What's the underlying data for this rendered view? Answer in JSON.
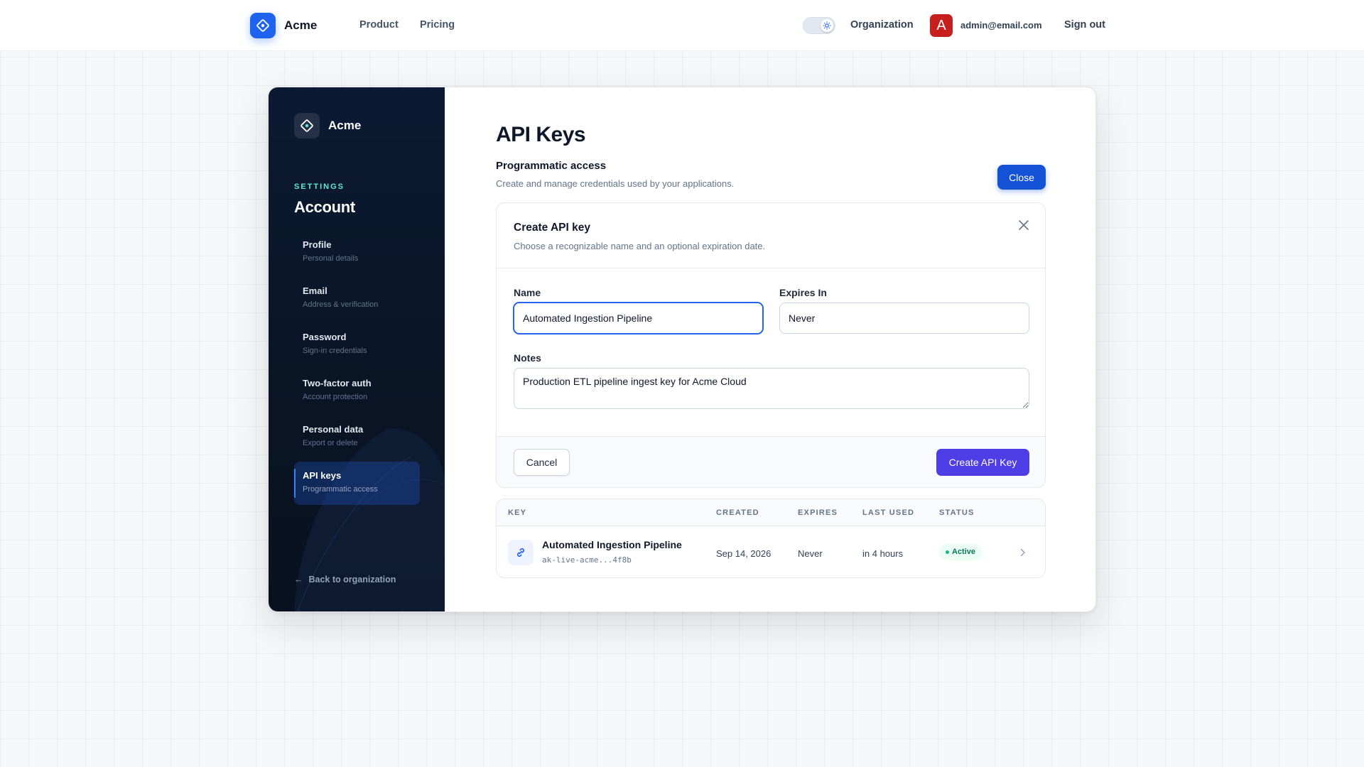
{
  "topnav": {
    "brand": "Acme",
    "links": {
      "product": "Product",
      "pricing": "Pricing"
    },
    "organization": "Organization",
    "avatar_initial": "A",
    "user_email": "admin@email.com",
    "sign_out": "Sign out"
  },
  "sidebar": {
    "brand": "Acme",
    "section": "SETTINGS",
    "title": "Account",
    "items": [
      {
        "label": "Profile",
        "sub": "Personal details"
      },
      {
        "label": "Email",
        "sub": "Address & verification"
      },
      {
        "label": "Password",
        "sub": "Sign-in credentials"
      },
      {
        "label": "Two-factor auth",
        "sub": "Account protection"
      },
      {
        "label": "Personal data",
        "sub": "Export or delete"
      },
      {
        "label": "API keys",
        "sub": "Programmatic access",
        "active": true
      }
    ],
    "back_arrow": "←",
    "back_label": "Back to organization"
  },
  "main": {
    "title": "API Keys",
    "section_title": "Programmatic access",
    "section_desc": "Create and manage credentials used by your applications.",
    "close_label": "Close",
    "form": {
      "title": "Create API key",
      "desc": "Choose a recognizable name and an optional expiration date.",
      "name_label": "Name",
      "name_value": "Automated Ingestion Pipeline",
      "expires_label": "Expires In",
      "expires_value": "Never",
      "notes_label": "Notes",
      "notes_value": "Production ETL pipeline ingest key for Acme Cloud",
      "cancel_label": "Cancel",
      "create_label": "Create API Key"
    },
    "table": {
      "headers": {
        "key": "KEY",
        "created": "CREATED",
        "expires": "EXPIRES",
        "last_used": "LAST USED",
        "status": "STATUS"
      },
      "rows": [
        {
          "name": "Automated Ingestion Pipeline",
          "masked": "ak-live-acme...4f8b",
          "created": "Sep 14, 2026",
          "expires": "Never",
          "last_used": "in 4 hours",
          "status": "Active"
        }
      ]
    }
  },
  "colors": {
    "brand_blue": "#1d63ed",
    "primary_button": "#1553d6",
    "create_button": "#4f3ee6",
    "sidebar_bg": "#0b1a33",
    "status_active": "#10b981",
    "avatar": "#c81e1e"
  },
  "icons": {
    "brand": "diamond-logo-icon",
    "theme": "sun-icon",
    "dismiss": "close-icon",
    "key": "link-icon",
    "row_action": "chevron-right-icon"
  }
}
